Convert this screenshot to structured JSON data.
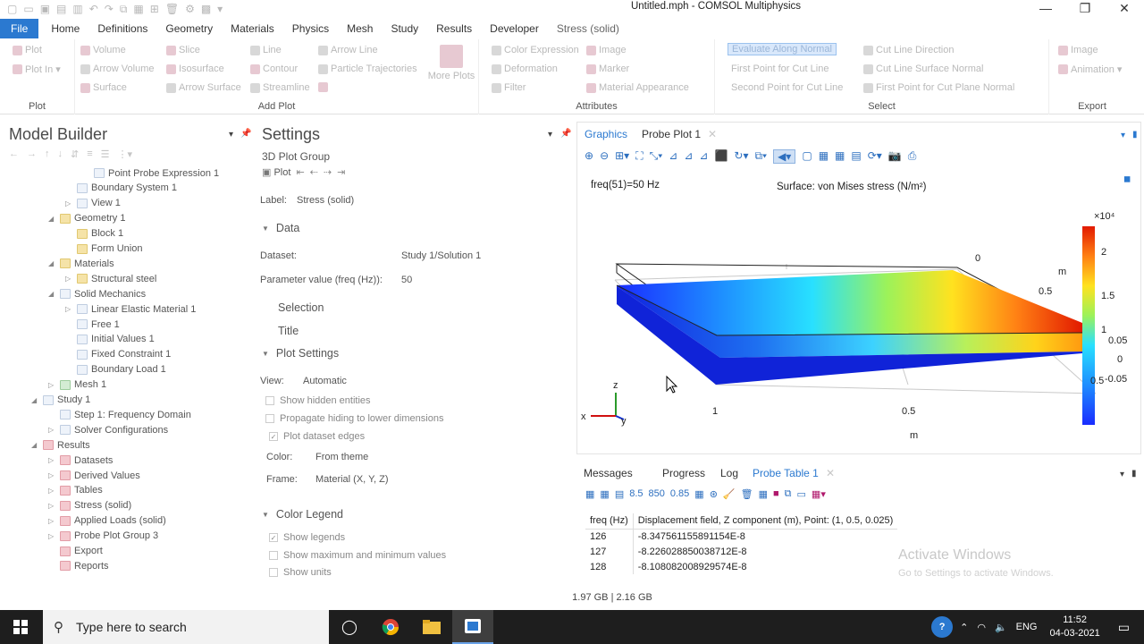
{
  "window": {
    "title": "Untitled.mph - COMSOL Multiphysics",
    "minimize": "—",
    "restore": "❐",
    "close": "✕"
  },
  "menu": {
    "file": "File",
    "tabs": [
      "Home",
      "Definitions",
      "Geometry",
      "Materials",
      "Physics",
      "Mesh",
      "Study",
      "Results",
      "Developer"
    ],
    "context_tab": "Stress (solid)"
  },
  "ribbon": {
    "plot_group": {
      "label": "Plot",
      "items": [
        "Plot",
        "Plot In"
      ]
    },
    "add_plot": {
      "label": "Add Plot",
      "items": [
        "Volume",
        "Arrow Volume",
        "Surface",
        "Slice",
        "Isosurface",
        "Arrow Surface",
        "Line",
        "Contour",
        "Streamline",
        "Arrow Line",
        "Particle Trajectories",
        "More Plots"
      ]
    },
    "attributes": {
      "label": "Attributes",
      "items": [
        "Color Expression",
        "Deformation",
        "Filter",
        "Image",
        "Marker",
        "Material Appearance"
      ]
    },
    "select": {
      "label": "Select",
      "items": [
        "Evaluate Along Normal",
        "First Point for Cut Line",
        "Second Point for Cut Line",
        "Cut Line Direction",
        "Cut Line Surface Normal",
        "First Point for Cut Plane Normal"
      ]
    },
    "export": {
      "label": "Export",
      "items": [
        "Image",
        "Animation"
      ]
    }
  },
  "model_builder": {
    "title": "Model Builder",
    "tree": [
      {
        "label": "Point Probe Expression 1",
        "indent": 4,
        "icon": "blue",
        "arrow": ""
      },
      {
        "label": "Boundary System 1",
        "indent": 3,
        "icon": "blue",
        "arrow": ""
      },
      {
        "label": "View 1",
        "indent": 3,
        "icon": "blue",
        "arrow": "▷"
      },
      {
        "label": "Geometry 1",
        "indent": 2,
        "icon": "yellow",
        "arrow": "◢"
      },
      {
        "label": "Block 1",
        "indent": 3,
        "icon": "yellow",
        "arrow": ""
      },
      {
        "label": "Form Union",
        "indent": 3,
        "icon": "yellow",
        "arrow": ""
      },
      {
        "label": "Materials",
        "indent": 2,
        "icon": "yellow",
        "arrow": "◢"
      },
      {
        "label": "Structural steel",
        "indent": 3,
        "icon": "yellow",
        "arrow": "▷"
      },
      {
        "label": "Solid Mechanics",
        "indent": 2,
        "icon": "blue",
        "arrow": "◢"
      },
      {
        "label": "Linear Elastic Material 1",
        "indent": 3,
        "icon": "blue",
        "arrow": "▷"
      },
      {
        "label": "Free 1",
        "indent": 3,
        "icon": "blue",
        "arrow": ""
      },
      {
        "label": "Initial Values 1",
        "indent": 3,
        "icon": "blue",
        "arrow": ""
      },
      {
        "label": "Fixed Constraint 1",
        "indent": 3,
        "icon": "blue",
        "arrow": ""
      },
      {
        "label": "Boundary Load 1",
        "indent": 3,
        "icon": "blue",
        "arrow": ""
      },
      {
        "label": "Mesh 1",
        "indent": 2,
        "icon": "green",
        "arrow": "▷"
      },
      {
        "label": "Study 1",
        "indent": 1,
        "icon": "blue",
        "arrow": "◢"
      },
      {
        "label": "Step 1: Frequency Domain",
        "indent": 2,
        "icon": "blue",
        "arrow": ""
      },
      {
        "label": "Solver Configurations",
        "indent": 2,
        "icon": "blue",
        "arrow": "▷"
      },
      {
        "label": "Results",
        "indent": 1,
        "icon": "red",
        "arrow": "◢"
      },
      {
        "label": "Datasets",
        "indent": 2,
        "icon": "red",
        "arrow": "▷"
      },
      {
        "label": "Derived Values",
        "indent": 2,
        "icon": "red",
        "arrow": "▷"
      },
      {
        "label": "Tables",
        "indent": 2,
        "icon": "red",
        "arrow": "▷"
      },
      {
        "label": "Stress (solid)",
        "indent": 2,
        "icon": "red",
        "arrow": "▷"
      },
      {
        "label": "Applied Loads (solid)",
        "indent": 2,
        "icon": "red",
        "arrow": "▷"
      },
      {
        "label": "Probe Plot Group 3",
        "indent": 2,
        "icon": "red",
        "arrow": "▷"
      },
      {
        "label": "Export",
        "indent": 2,
        "icon": "red",
        "arrow": ""
      },
      {
        "label": "Reports",
        "indent": 2,
        "icon": "red",
        "arrow": ""
      }
    ]
  },
  "settings": {
    "title": "Settings",
    "subtitle": "3D Plot Group",
    "plot_button": "Plot",
    "label_label": "Label:",
    "label_value": "Stress (solid)",
    "sections": {
      "data": "Data",
      "selection": "Selection",
      "title": "Title",
      "plot_settings": "Plot Settings",
      "color_legend": "Color Legend"
    },
    "dataset_label": "Dataset:",
    "dataset_value": "Study 1/Solution 1",
    "param_label": "Parameter value (freq (Hz)):",
    "param_value": "50",
    "view_label": "View:",
    "view_value": "Automatic",
    "checks": {
      "hidden": "Show hidden entities",
      "propagate": "Propagate hiding to lower dimensions",
      "edges": "Plot dataset edges",
      "legends": "Show legends",
      "maxmin": "Show maximum and minimum values",
      "units": "Show units"
    },
    "color_label": "Color:",
    "color_value": "From theme",
    "frame_label": "Frame:",
    "frame_value": "Material  (X, Y, Z)"
  },
  "graphics": {
    "tabs": [
      "Graphics",
      "Probe Plot 1"
    ],
    "freq_text": "freq(51)=50 Hz",
    "plot_title": "Surface: von Mises stress (N/m²)",
    "legend_exp": "×10⁴",
    "legend_ticks": [
      "2",
      "1.5",
      "1",
      "0.5"
    ],
    "axis_labels": {
      "x_ticks": [
        "1",
        "0.5"
      ],
      "x_unit": "m",
      "y_ticks": [
        "0",
        "0.5",
        "1"
      ],
      "y_unit": "m",
      "z_ticks": [
        "0.05",
        "0",
        "-0.05"
      ],
      "tri_x": "x",
      "tri_y": "y",
      "tri_z": "z"
    }
  },
  "messages": {
    "tabs": [
      "Messages",
      "Progress",
      "Log",
      "Probe Table 1"
    ],
    "table": {
      "headers": [
        "freq (Hz)",
        "Displacement field, Z component (m), Point: (1, 0.5, 0.025)"
      ],
      "rows": [
        [
          "126",
          "-8.347561155891154E-8"
        ],
        [
          "127",
          "-8.226028850038712E-8"
        ],
        [
          "128",
          "-8.108082008929574E-8"
        ]
      ]
    }
  },
  "status": {
    "memory": "1.97 GB | 2.16 GB"
  },
  "watermark": {
    "line1": "Activate Windows",
    "line2": "Go to Settings to activate Windows."
  },
  "taskbar": {
    "search_placeholder": "Type here to search",
    "lang": "ENG",
    "time": "11:52",
    "date": "04-03-2021"
  },
  "colors": {
    "accent": "#2b79d0",
    "colormap_low": "#1a2cff",
    "colormap_high": "#e00000"
  }
}
